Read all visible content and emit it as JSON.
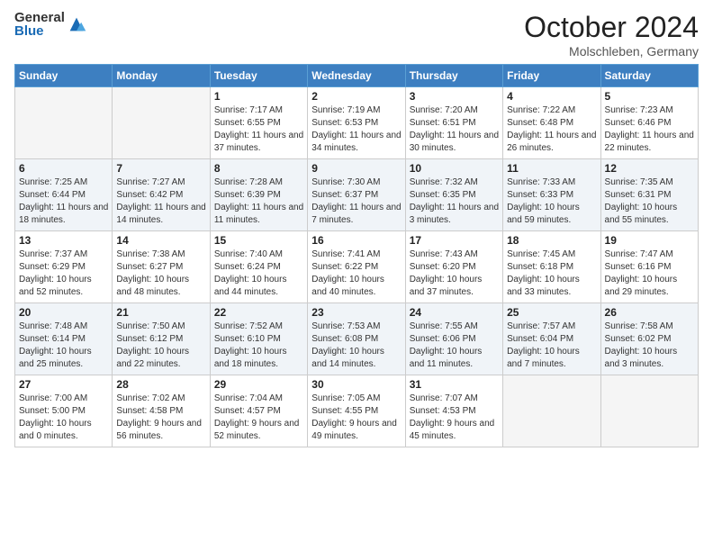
{
  "header": {
    "logo_general": "General",
    "logo_blue": "Blue",
    "month_title": "October 2024",
    "location": "Molschleben, Germany"
  },
  "days_of_week": [
    "Sunday",
    "Monday",
    "Tuesday",
    "Wednesday",
    "Thursday",
    "Friday",
    "Saturday"
  ],
  "weeks": [
    [
      {
        "day": "",
        "info": ""
      },
      {
        "day": "",
        "info": ""
      },
      {
        "day": "1",
        "info": "Sunrise: 7:17 AM\nSunset: 6:55 PM\nDaylight: 11 hours and 37 minutes."
      },
      {
        "day": "2",
        "info": "Sunrise: 7:19 AM\nSunset: 6:53 PM\nDaylight: 11 hours and 34 minutes."
      },
      {
        "day": "3",
        "info": "Sunrise: 7:20 AM\nSunset: 6:51 PM\nDaylight: 11 hours and 30 minutes."
      },
      {
        "day": "4",
        "info": "Sunrise: 7:22 AM\nSunset: 6:48 PM\nDaylight: 11 hours and 26 minutes."
      },
      {
        "day": "5",
        "info": "Sunrise: 7:23 AM\nSunset: 6:46 PM\nDaylight: 11 hours and 22 minutes."
      }
    ],
    [
      {
        "day": "6",
        "info": "Sunrise: 7:25 AM\nSunset: 6:44 PM\nDaylight: 11 hours and 18 minutes."
      },
      {
        "day": "7",
        "info": "Sunrise: 7:27 AM\nSunset: 6:42 PM\nDaylight: 11 hours and 14 minutes."
      },
      {
        "day": "8",
        "info": "Sunrise: 7:28 AM\nSunset: 6:39 PM\nDaylight: 11 hours and 11 minutes."
      },
      {
        "day": "9",
        "info": "Sunrise: 7:30 AM\nSunset: 6:37 PM\nDaylight: 11 hours and 7 minutes."
      },
      {
        "day": "10",
        "info": "Sunrise: 7:32 AM\nSunset: 6:35 PM\nDaylight: 11 hours and 3 minutes."
      },
      {
        "day": "11",
        "info": "Sunrise: 7:33 AM\nSunset: 6:33 PM\nDaylight: 10 hours and 59 minutes."
      },
      {
        "day": "12",
        "info": "Sunrise: 7:35 AM\nSunset: 6:31 PM\nDaylight: 10 hours and 55 minutes."
      }
    ],
    [
      {
        "day": "13",
        "info": "Sunrise: 7:37 AM\nSunset: 6:29 PM\nDaylight: 10 hours and 52 minutes."
      },
      {
        "day": "14",
        "info": "Sunrise: 7:38 AM\nSunset: 6:27 PM\nDaylight: 10 hours and 48 minutes."
      },
      {
        "day": "15",
        "info": "Sunrise: 7:40 AM\nSunset: 6:24 PM\nDaylight: 10 hours and 44 minutes."
      },
      {
        "day": "16",
        "info": "Sunrise: 7:41 AM\nSunset: 6:22 PM\nDaylight: 10 hours and 40 minutes."
      },
      {
        "day": "17",
        "info": "Sunrise: 7:43 AM\nSunset: 6:20 PM\nDaylight: 10 hours and 37 minutes."
      },
      {
        "day": "18",
        "info": "Sunrise: 7:45 AM\nSunset: 6:18 PM\nDaylight: 10 hours and 33 minutes."
      },
      {
        "day": "19",
        "info": "Sunrise: 7:47 AM\nSunset: 6:16 PM\nDaylight: 10 hours and 29 minutes."
      }
    ],
    [
      {
        "day": "20",
        "info": "Sunrise: 7:48 AM\nSunset: 6:14 PM\nDaylight: 10 hours and 25 minutes."
      },
      {
        "day": "21",
        "info": "Sunrise: 7:50 AM\nSunset: 6:12 PM\nDaylight: 10 hours and 22 minutes."
      },
      {
        "day": "22",
        "info": "Sunrise: 7:52 AM\nSunset: 6:10 PM\nDaylight: 10 hours and 18 minutes."
      },
      {
        "day": "23",
        "info": "Sunrise: 7:53 AM\nSunset: 6:08 PM\nDaylight: 10 hours and 14 minutes."
      },
      {
        "day": "24",
        "info": "Sunrise: 7:55 AM\nSunset: 6:06 PM\nDaylight: 10 hours and 11 minutes."
      },
      {
        "day": "25",
        "info": "Sunrise: 7:57 AM\nSunset: 6:04 PM\nDaylight: 10 hours and 7 minutes."
      },
      {
        "day": "26",
        "info": "Sunrise: 7:58 AM\nSunset: 6:02 PM\nDaylight: 10 hours and 3 minutes."
      }
    ],
    [
      {
        "day": "27",
        "info": "Sunrise: 7:00 AM\nSunset: 5:00 PM\nDaylight: 10 hours and 0 minutes."
      },
      {
        "day": "28",
        "info": "Sunrise: 7:02 AM\nSunset: 4:58 PM\nDaylight: 9 hours and 56 minutes."
      },
      {
        "day": "29",
        "info": "Sunrise: 7:04 AM\nSunset: 4:57 PM\nDaylight: 9 hours and 52 minutes."
      },
      {
        "day": "30",
        "info": "Sunrise: 7:05 AM\nSunset: 4:55 PM\nDaylight: 9 hours and 49 minutes."
      },
      {
        "day": "31",
        "info": "Sunrise: 7:07 AM\nSunset: 4:53 PM\nDaylight: 9 hours and 45 minutes."
      },
      {
        "day": "",
        "info": ""
      },
      {
        "day": "",
        "info": ""
      }
    ]
  ]
}
